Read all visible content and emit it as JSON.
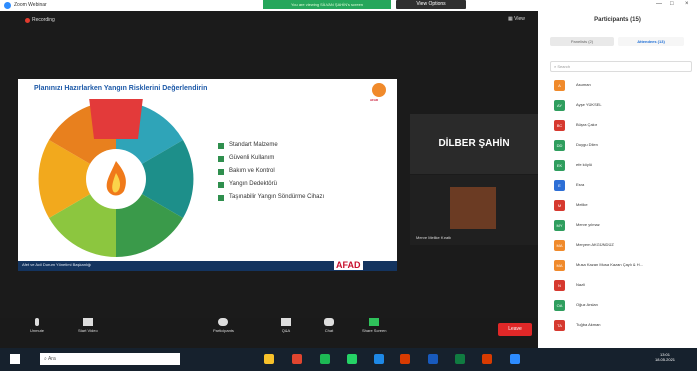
{
  "window": {
    "title": "Zoom Webinar",
    "banner": "You are viewing SİLVAN ŞAHİN's screen",
    "view_options": "View Options"
  },
  "meeting": {
    "recording": "Recording",
    "view_button": "View"
  },
  "slide": {
    "title": "Planınızı Hazırlarken Yangın Risklerini Değerlendirin",
    "legend": [
      {
        "label": "Standart Malzeme",
        "color": "#2f8f4e"
      },
      {
        "label": "Güvenli Kullanım",
        "color": "#2f8f4e"
      },
      {
        "label": "Bakım ve Kontrol",
        "color": "#2f8f4e"
      },
      {
        "label": "Yangın Dedektörü",
        "color": "#2f8f4e"
      },
      {
        "label": "Taşınabilir Yangın Söndürme Cihazı",
        "color": "#2f8f4e"
      }
    ],
    "footer": "Afet ve Acil Durum Yönetimi Başkanlığı",
    "logo": "AFAD"
  },
  "tiles": {
    "dilber": "DİLBER ŞAHİN",
    "video_name": "Merve Melike Kıratlı"
  },
  "toolbar": {
    "mute": "Unmute",
    "start_video": "Start Video",
    "participants": "Participants",
    "q_and_a": "Q&A",
    "chat": "Chat",
    "share": "Share Screen",
    "end": "Leave"
  },
  "participants": {
    "title": "Participants (15)",
    "tab_host": "Panelists (2)",
    "tab_attendees": "Attendees (13)",
    "search_placeholder": "Search",
    "list": [
      {
        "initials": "A",
        "name": "Asuman",
        "color": "#f08a2b"
      },
      {
        "initials": "AY",
        "name": "Ayşe YÜKSEL",
        "color": "#2f9e5e"
      },
      {
        "initials": "BC",
        "name": "Büşra Çakır",
        "color": "#d6392f"
      },
      {
        "initials": "DD",
        "name": "Duygu Dilen",
        "color": "#2f9e5e"
      },
      {
        "initials": "EK",
        "name": "efe köylü",
        "color": "#2f9e5e"
      },
      {
        "initials": "E",
        "name": "Esra",
        "color": "#2d6fd6"
      },
      {
        "initials": "M",
        "name": "Melike",
        "color": "#d6392f"
      },
      {
        "initials": "MY",
        "name": "Merve yılmaz",
        "color": "#2f9e5e"
      },
      {
        "initials": "MA",
        "name": "Meryem AKGÜNDÜZ",
        "color": "#f08a2b"
      },
      {
        "initials": "MA",
        "name": "Musa Kazan Musa Kazan Çaylı & H...",
        "color": "#f08a2b"
      },
      {
        "initials": "N",
        "name": "Nazli",
        "color": "#d6392f"
      },
      {
        "initials": "OA",
        "name": "Oğuz Arslan",
        "color": "#2f9e5e"
      },
      {
        "initials": "TA",
        "name": "Tuğba Akman",
        "color": "#d6392f"
      }
    ]
  },
  "taskbar": {
    "search": "Ara",
    "time": "13:01",
    "date": "18.05.2021"
  }
}
